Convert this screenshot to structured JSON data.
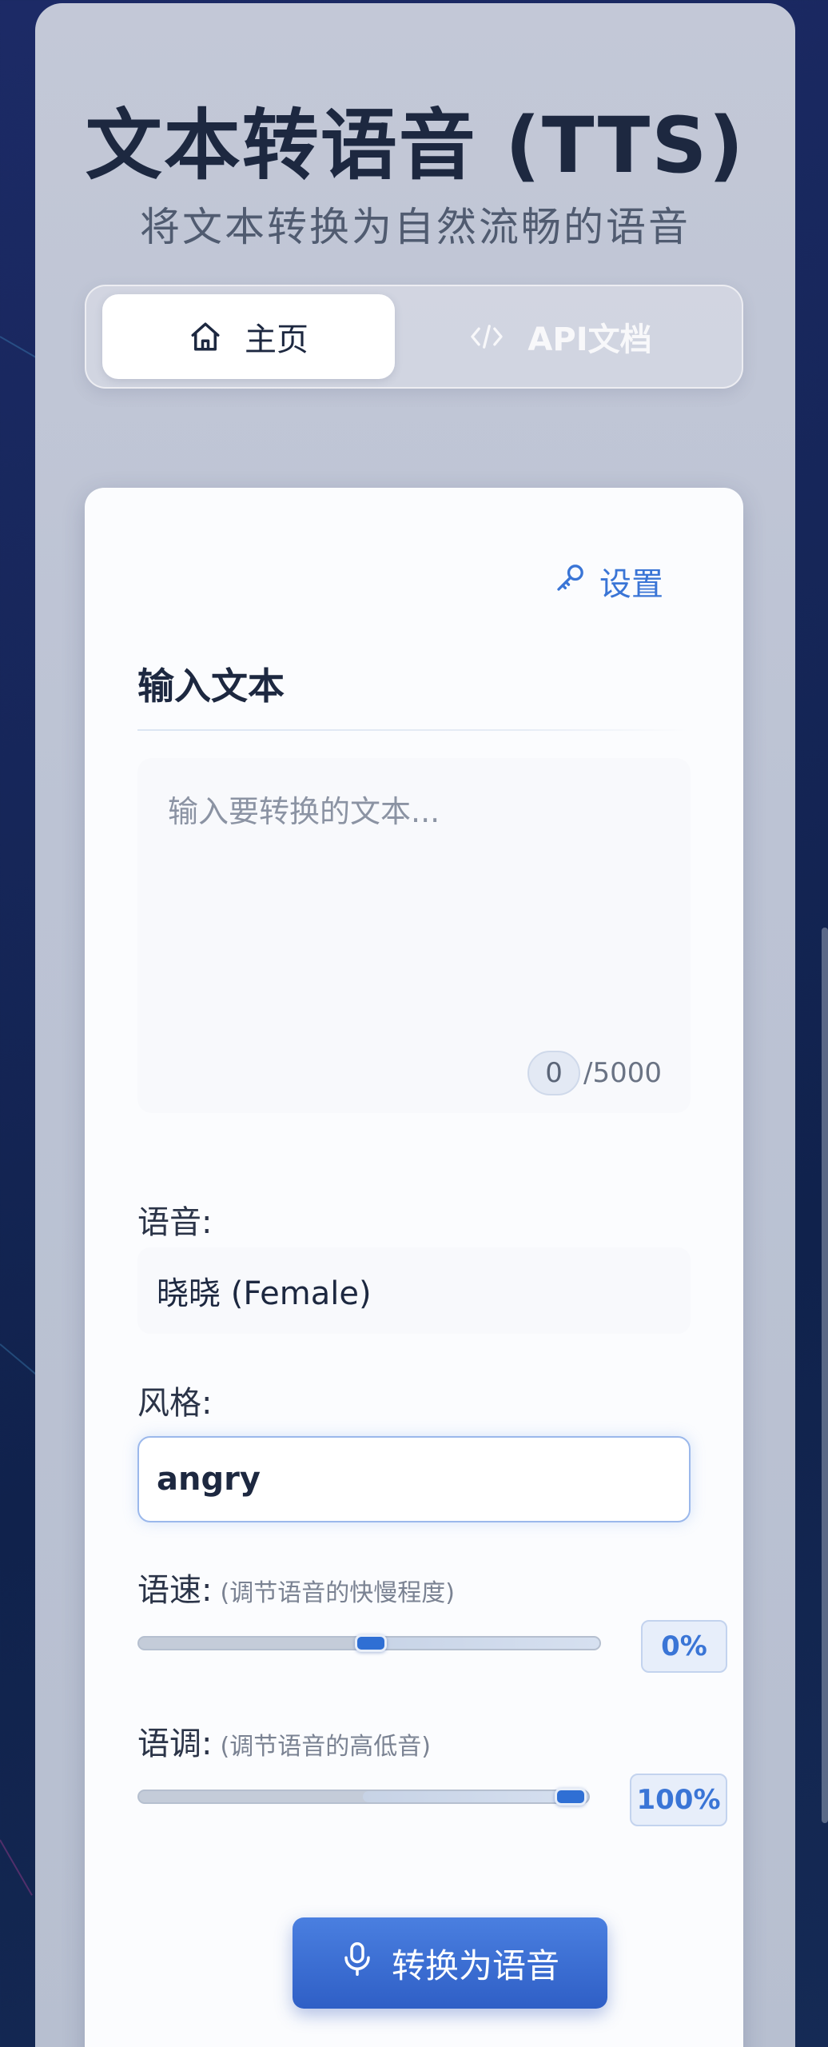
{
  "header": {
    "title": "文本转语音 (TTS)",
    "subtitle": "将文本转换为自然流畅的语音"
  },
  "tabs": [
    {
      "label": "主页",
      "icon": "home-icon",
      "active": true
    },
    {
      "label": "API文档",
      "icon": "code-icon",
      "active": false
    }
  ],
  "settings": {
    "label": "设置",
    "icon": "key-icon"
  },
  "input_section": {
    "title": "输入文本",
    "placeholder": "输入要转换的文本...",
    "value": "",
    "char_count": "0",
    "char_max": "/5000"
  },
  "voice": {
    "label": "语音:",
    "selected": "晓晓 (Female)"
  },
  "style": {
    "label": "风格:",
    "value": "angry"
  },
  "speed": {
    "label": "语速:",
    "hint": "(调节语音的快慢程度)",
    "value_text": "0%",
    "level": 0.5
  },
  "pitch": {
    "label": "语调:",
    "hint": "(调节语音的高低音)",
    "value_text": "100%",
    "level": 1.0
  },
  "convert_button": {
    "label": "转换为语音",
    "icon": "microphone-icon"
  },
  "colors": {
    "accent": "#3a75d6",
    "button": "#3a6ad6",
    "title": "#1d2840"
  }
}
